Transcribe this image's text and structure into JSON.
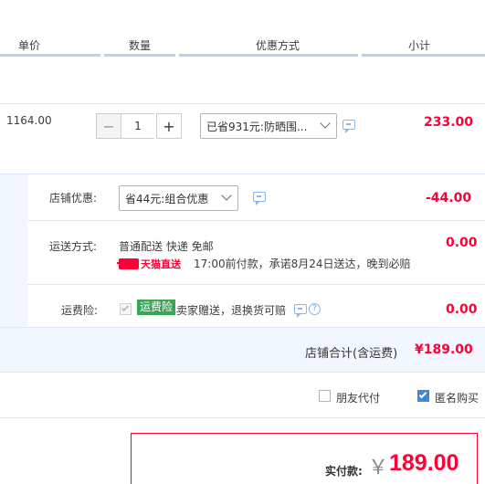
{
  "header": {
    "col_price": "单价",
    "col_qty": "数量",
    "col_discount": "优惠方式",
    "col_subtotal": "小计"
  },
  "item": {
    "unit_price": "1164.00",
    "quantity": "1",
    "minus": "−",
    "plus": "+",
    "discount_select": "已省931元:防晒围...",
    "subtotal": "233.00"
  },
  "shop": {
    "discount_label": "店铺优惠:",
    "discount_select": "省44元:组合优惠",
    "discount_value": "-44.00",
    "shipping_label": "运送方式:",
    "shipping_method": "普通配送 快递 免邮",
    "tmall_name": "天猫直送",
    "shipping_note": "17:00前付款，承诺8月24日送达，晚到必赔",
    "shipping_value": "0.00",
    "insurance_label": "运费险:",
    "insurance_badge": "运费险",
    "insurance_note": "卖家赠送，退换货可赔",
    "insurance_value": "0.00",
    "total_label": "店铺合计(含运费)",
    "total_value": "¥189.00"
  },
  "options": {
    "friend_pay": "朋友代付",
    "anonymous": "匿名购买"
  },
  "payment": {
    "label": "实付款:",
    "currency": "￥",
    "amount": "189.00"
  },
  "colors": {
    "accent_red": "#ff0036",
    "accent_blue": "#3d88e2",
    "badge_green": "#3aa457"
  }
}
